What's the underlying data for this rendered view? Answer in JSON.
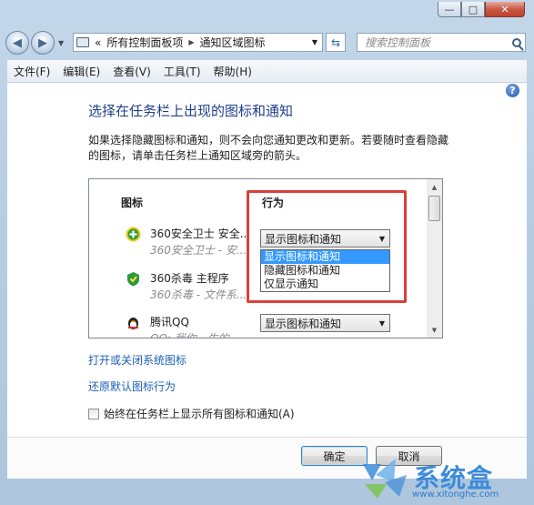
{
  "window": {
    "caption_buttons": {
      "minimize": "—",
      "maximize": "□",
      "close": "✕"
    }
  },
  "address_bar": {
    "prefix": "«",
    "segments": [
      "所有控制面板项",
      "通知区域图标"
    ],
    "search_placeholder": "搜索控制面板"
  },
  "menu": [
    "文件(F)",
    "编辑(E)",
    "查看(V)",
    "工具(T)",
    "帮助(H)"
  ],
  "page": {
    "title": "选择在任务栏上出现的图标和通知",
    "description": "如果选择隐藏图标和通知，则不会向您通知更改和更新。若要随时查看隐藏的图标，请单击任务栏上通知区域旁的箭头。"
  },
  "table": {
    "col_icon": "图标",
    "col_behavior": "行为",
    "rows": [
      {
        "name": "360安全卫士 安全...",
        "sub": "360安全卫士 - 安...",
        "behavior": "显示图标和通知",
        "icon": "360-safe-icon"
      },
      {
        "name": "360杀毒 主程序",
        "sub": "360杀毒 - 文件系...",
        "behavior": "显示图标和通知",
        "icon": "360-antivirus-icon"
      },
      {
        "name": "腾讯QQ",
        "sub": "QQ: 我你一生的...",
        "behavior": "显示图标和通知",
        "icon": "qq-penguin-icon"
      }
    ],
    "dropdown_options": [
      "显示图标和通知",
      "隐藏图标和通知",
      "仅显示通知"
    ],
    "dropdown_selected_index": 0
  },
  "links": {
    "system_icons": "打开或关闭系统图标",
    "restore_defaults": "还原默认图标行为"
  },
  "checkbox": {
    "label": "始终在任务栏上显示所有图标和通知(A)",
    "checked": false
  },
  "buttons": {
    "ok": "确定",
    "cancel": "取消"
  },
  "watermark": {
    "text": "系统盒",
    "url": "www.xitonghe.com"
  },
  "colors": {
    "highlight_box": "#d9403a",
    "link": "#1d5fb5",
    "title": "#1d3f8a",
    "selection": "#3399ff"
  }
}
